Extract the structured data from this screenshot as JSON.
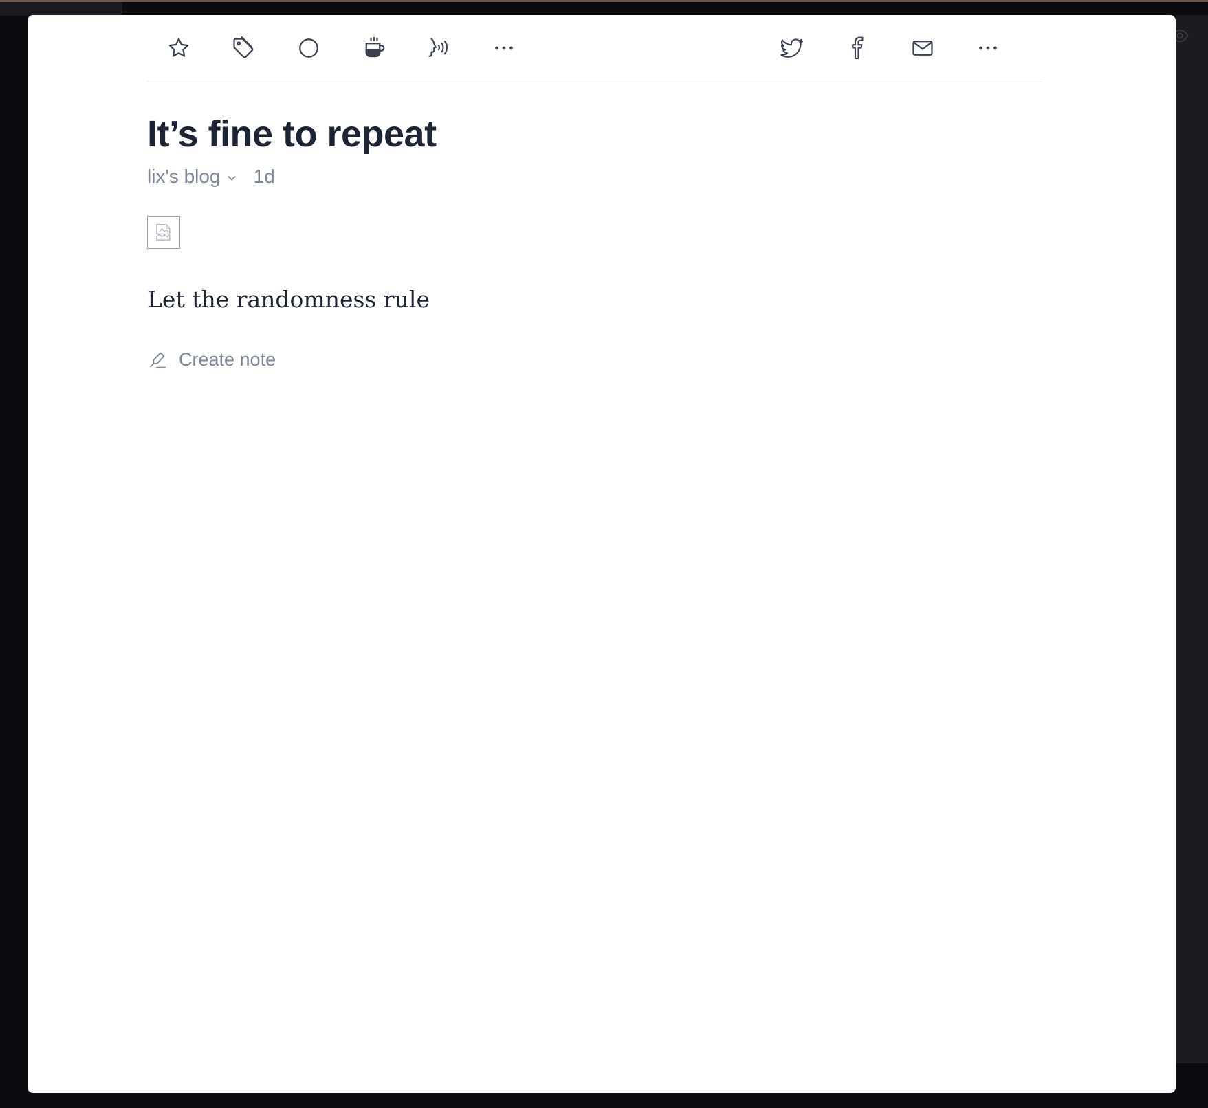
{
  "toolbar": {
    "left_icons": [
      "star-icon",
      "tag-icon",
      "circle-icon",
      "coffee-icon",
      "text-to-speech-icon",
      "more-horizontal-icon"
    ],
    "right_icons": [
      "twitter-icon",
      "facebook-icon",
      "mail-icon",
      "more-horizontal-icon"
    ]
  },
  "article": {
    "title": "It’s fine to repeat",
    "feed_name": "lix's blog",
    "age": "1d",
    "body": "Let the randomness rule"
  },
  "actions": {
    "create_note_label": "Create note"
  },
  "colors": {
    "title": "#1d2433",
    "meta": "#7c8797",
    "icon": "#3a4250",
    "divider": "#e4e7eb",
    "card_background": "#ffffff",
    "page_background": "#0b0c10"
  }
}
